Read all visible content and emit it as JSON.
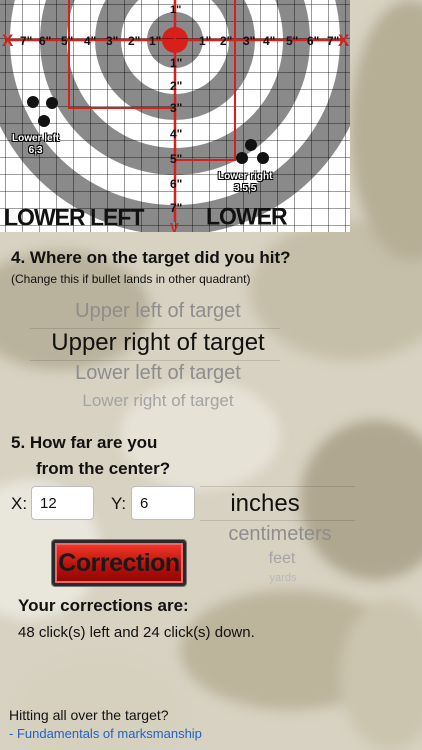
{
  "target": {
    "quadrant_left": "LOWER LEFT",
    "quadrant_right": "LOWER RIGHT",
    "horizontal_ticks": [
      "7\"",
      "6\"",
      "5\"",
      "4\"",
      "3\"",
      "2\"",
      "1\"",
      "1\"",
      "2\"",
      "3\"",
      "4\"",
      "5\"",
      "6\"",
      "7\""
    ],
    "vertical_ticks": [
      "1\"",
      "2\"",
      "3\"",
      "4\"",
      "5\"",
      "6\"",
      "7\""
    ],
    "top_tick": "1\"",
    "end_markers": [
      "X",
      "X"
    ],
    "bottom_marker": "V",
    "lower_left_group_name": "Lower left",
    "lower_left_group_coords": "6,3",
    "lower_right_group_name": "Lower right",
    "lower_right_group_coords": "3.5,5"
  },
  "question4": {
    "title": "4.  Where on the target did you hit?",
    "subtitle": "(Change this if bullet lands in other quadrant)",
    "options": [
      "Upper left of target",
      "Upper right of target",
      "Lower left of target",
      "Lower right of target"
    ],
    "selected": "Upper right of target"
  },
  "question5": {
    "title_line1": "5.  How far are you",
    "title_line2": "from the center?",
    "x_label": "X:",
    "x_value": "12",
    "y_label": "Y:",
    "y_value": "6",
    "units": [
      "inches",
      "centimeters",
      "feet",
      "yards"
    ],
    "selected_unit": "inches"
  },
  "correction_button": "Correction",
  "results": {
    "title": "Your corrections are:",
    "text": "48 click(s) left and 24 click(s) down."
  },
  "footer": {
    "question": "Hitting all over the target?",
    "link": "- Fundamentals of marksmanship"
  },
  "colors": {
    "accent_red": "#d81f1a",
    "link_blue": "#1e63c9",
    "ring_gray": "#8a8a8a"
  }
}
